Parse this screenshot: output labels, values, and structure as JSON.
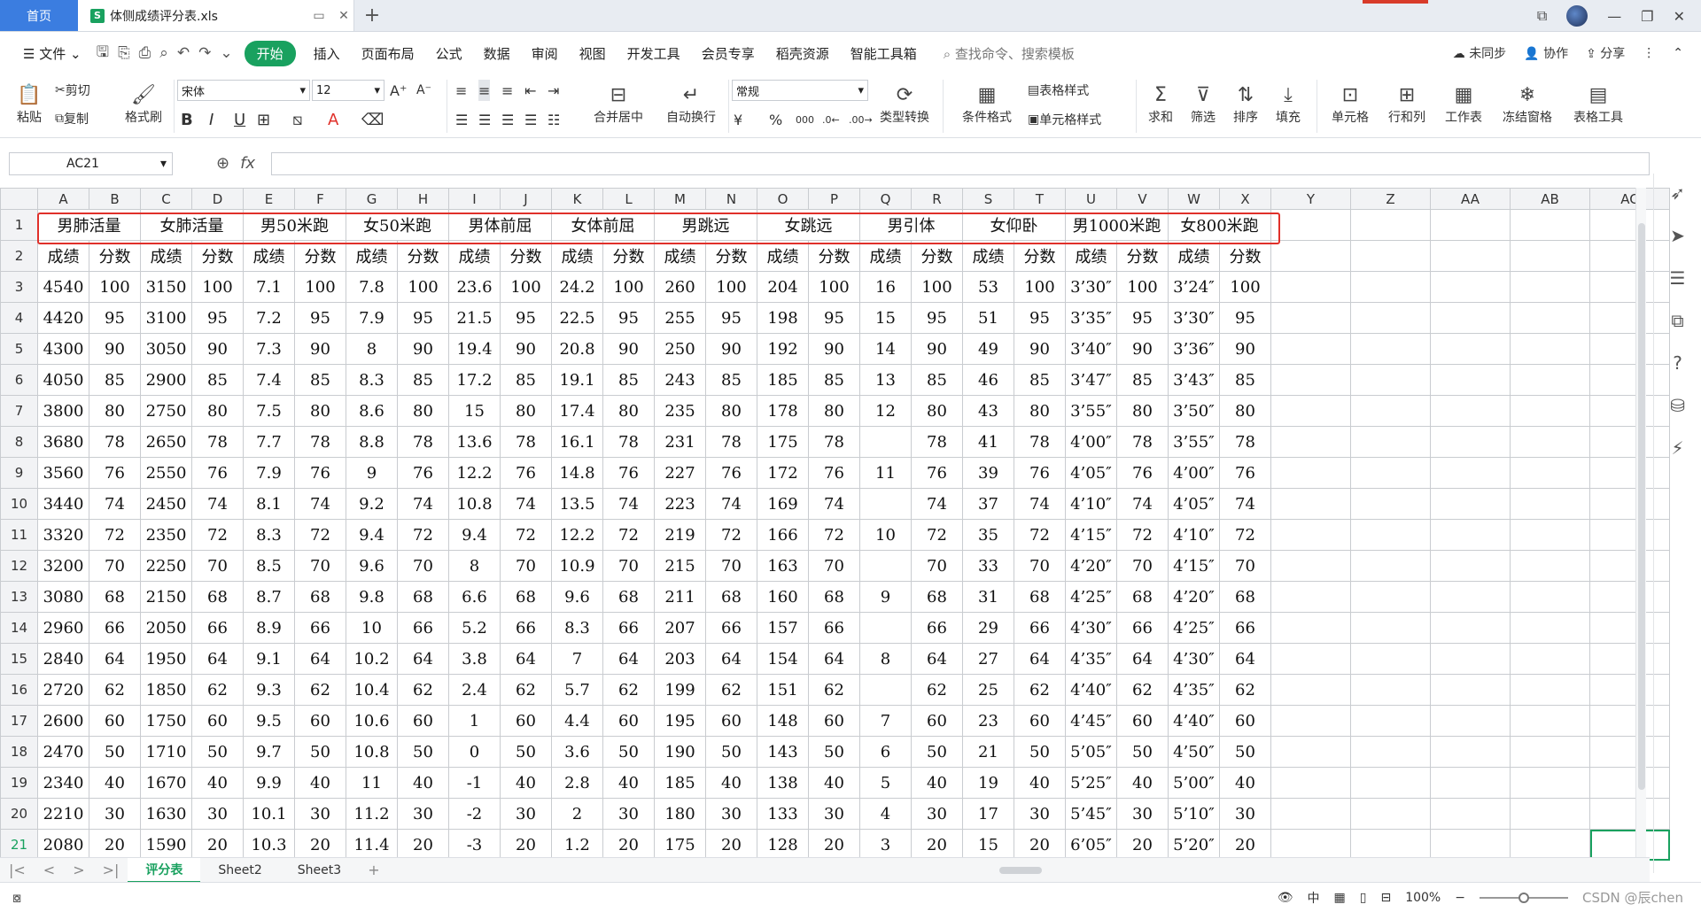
{
  "tabs": {
    "home": "首页",
    "file": "体侧成绩评分表.xls"
  },
  "menu": {
    "file": "文件",
    "start": "开始",
    "items": [
      "插入",
      "页面布局",
      "公式",
      "数据",
      "审阅",
      "视图",
      "开发工具",
      "会员专享",
      "稻壳资源",
      "智能工具箱"
    ],
    "search": "查找命令、搜索模板",
    "sync": "未同步",
    "collab": "协作",
    "share": "分享"
  },
  "ribbon": {
    "paste": "粘贴",
    "cut": "剪切",
    "copy": "复制",
    "format_painter": "格式刷",
    "font_name": "宋体",
    "font_size": "12",
    "merge": "合并居中",
    "wrap": "自动换行",
    "number_format": "常规",
    "convert": "类型转换",
    "cond_format": "条件格式",
    "table_style": "表格样式",
    "cell_style": "单元格样式",
    "sum": "求和",
    "filter": "筛选",
    "sort": "排序",
    "fill": "填充",
    "cell": "单元格",
    "rowcol": "行和列",
    "sheet": "工作表",
    "freeze": "冻结窗格",
    "tools": "表格工具"
  },
  "formula": {
    "namebox": "AC21",
    "fx": "fx"
  },
  "columns": [
    "A",
    "B",
    "C",
    "D",
    "E",
    "F",
    "G",
    "H",
    "I",
    "J",
    "K",
    "L",
    "M",
    "N",
    "O",
    "P",
    "Q",
    "R",
    "S",
    "T",
    "U",
    "V",
    "W",
    "X",
    "Y",
    "Z",
    "AA",
    "AB",
    "AC"
  ],
  "header_row": [
    "男肺活量",
    "女肺活量",
    "男50米跑",
    "女50米跑",
    "男体前屈",
    "女体前屈",
    "男跳远",
    "女跳远",
    "男引体",
    "女仰卧",
    "男1000米跑",
    "女800米跑"
  ],
  "sub_header": [
    "成绩",
    "分数"
  ],
  "rows": [
    [
      "4540",
      "100",
      "3150",
      "100",
      "7.1",
      "100",
      "7.8",
      "100",
      "23.6",
      "100",
      "24.2",
      "100",
      "260",
      "100",
      "204",
      "100",
      "16",
      "100",
      "53",
      "100",
      "3’30″",
      "100",
      "3’24″",
      "100"
    ],
    [
      "4420",
      "95",
      "3100",
      "95",
      "7.2",
      "95",
      "7.9",
      "95",
      "21.5",
      "95",
      "22.5",
      "95",
      "255",
      "95",
      "198",
      "95",
      "15",
      "95",
      "51",
      "95",
      "3’35″",
      "95",
      "3’30″",
      "95"
    ],
    [
      "4300",
      "90",
      "3050",
      "90",
      "7.3",
      "90",
      "8",
      "90",
      "19.4",
      "90",
      "20.8",
      "90",
      "250",
      "90",
      "192",
      "90",
      "14",
      "90",
      "49",
      "90",
      "3’40″",
      "90",
      "3’36″",
      "90"
    ],
    [
      "4050",
      "85",
      "2900",
      "85",
      "7.4",
      "85",
      "8.3",
      "85",
      "17.2",
      "85",
      "19.1",
      "85",
      "243",
      "85",
      "185",
      "85",
      "13",
      "85",
      "46",
      "85",
      "3’47″",
      "85",
      "3’43″",
      "85"
    ],
    [
      "3800",
      "80",
      "2750",
      "80",
      "7.5",
      "80",
      "8.6",
      "80",
      "15",
      "80",
      "17.4",
      "80",
      "235",
      "80",
      "178",
      "80",
      "12",
      "80",
      "43",
      "80",
      "3’55″",
      "80",
      "3’50″",
      "80"
    ],
    [
      "3680",
      "78",
      "2650",
      "78",
      "7.7",
      "78",
      "8.8",
      "78",
      "13.6",
      "78",
      "16.1",
      "78",
      "231",
      "78",
      "175",
      "78",
      "",
      "78",
      "41",
      "78",
      "4’00″",
      "78",
      "3’55″",
      "78"
    ],
    [
      "3560",
      "76",
      "2550",
      "76",
      "7.9",
      "76",
      "9",
      "76",
      "12.2",
      "76",
      "14.8",
      "76",
      "227",
      "76",
      "172",
      "76",
      "11",
      "76",
      "39",
      "76",
      "4’05″",
      "76",
      "4’00″",
      "76"
    ],
    [
      "3440",
      "74",
      "2450",
      "74",
      "8.1",
      "74",
      "9.2",
      "74",
      "10.8",
      "74",
      "13.5",
      "74",
      "223",
      "74",
      "169",
      "74",
      "",
      "74",
      "37",
      "74",
      "4’10″",
      "74",
      "4’05″",
      "74"
    ],
    [
      "3320",
      "72",
      "2350",
      "72",
      "8.3",
      "72",
      "9.4",
      "72",
      "9.4",
      "72",
      "12.2",
      "72",
      "219",
      "72",
      "166",
      "72",
      "10",
      "72",
      "35",
      "72",
      "4’15″",
      "72",
      "4’10″",
      "72"
    ],
    [
      "3200",
      "70",
      "2250",
      "70",
      "8.5",
      "70",
      "9.6",
      "70",
      "8",
      "70",
      "10.9",
      "70",
      "215",
      "70",
      "163",
      "70",
      "",
      "70",
      "33",
      "70",
      "4’20″",
      "70",
      "4’15″",
      "70"
    ],
    [
      "3080",
      "68",
      "2150",
      "68",
      "8.7",
      "68",
      "9.8",
      "68",
      "6.6",
      "68",
      "9.6",
      "68",
      "211",
      "68",
      "160",
      "68",
      "9",
      "68",
      "31",
      "68",
      "4’25″",
      "68",
      "4’20″",
      "68"
    ],
    [
      "2960",
      "66",
      "2050",
      "66",
      "8.9",
      "66",
      "10",
      "66",
      "5.2",
      "66",
      "8.3",
      "66",
      "207",
      "66",
      "157",
      "66",
      "",
      "66",
      "29",
      "66",
      "4’30″",
      "66",
      "4’25″",
      "66"
    ],
    [
      "2840",
      "64",
      "1950",
      "64",
      "9.1",
      "64",
      "10.2",
      "64",
      "3.8",
      "64",
      "7",
      "64",
      "203",
      "64",
      "154",
      "64",
      "8",
      "64",
      "27",
      "64",
      "4’35″",
      "64",
      "4’30″",
      "64"
    ],
    [
      "2720",
      "62",
      "1850",
      "62",
      "9.3",
      "62",
      "10.4",
      "62",
      "2.4",
      "62",
      "5.7",
      "62",
      "199",
      "62",
      "151",
      "62",
      "",
      "62",
      "25",
      "62",
      "4’40″",
      "62",
      "4’35″",
      "62"
    ],
    [
      "2600",
      "60",
      "1750",
      "60",
      "9.5",
      "60",
      "10.6",
      "60",
      "1",
      "60",
      "4.4",
      "60",
      "195",
      "60",
      "148",
      "60",
      "7",
      "60",
      "23",
      "60",
      "4’45″",
      "60",
      "4’40″",
      "60"
    ],
    [
      "2470",
      "50",
      "1710",
      "50",
      "9.7",
      "50",
      "10.8",
      "50",
      "0",
      "50",
      "3.6",
      "50",
      "190",
      "50",
      "143",
      "50",
      "6",
      "50",
      "21",
      "50",
      "5’05″",
      "50",
      "4’50″",
      "50"
    ],
    [
      "2340",
      "40",
      "1670",
      "40",
      "9.9",
      "40",
      "11",
      "40",
      "-1",
      "40",
      "2.8",
      "40",
      "185",
      "40",
      "138",
      "40",
      "5",
      "40",
      "19",
      "40",
      "5’25″",
      "40",
      "5’00″",
      "40"
    ],
    [
      "2210",
      "30",
      "1630",
      "30",
      "10.1",
      "30",
      "11.2",
      "30",
      "-2",
      "30",
      "2",
      "30",
      "180",
      "30",
      "133",
      "30",
      "4",
      "30",
      "17",
      "30",
      "5’45″",
      "30",
      "5’10″",
      "30"
    ],
    [
      "2080",
      "20",
      "1590",
      "20",
      "10.3",
      "20",
      "11.4",
      "20",
      "-3",
      "20",
      "1.2",
      "20",
      "175",
      "20",
      "128",
      "20",
      "3",
      "20",
      "15",
      "20",
      "6’05″",
      "20",
      "5’20″",
      "20"
    ]
  ],
  "sheets": [
    "评分表",
    "Sheet2",
    "Sheet3"
  ],
  "status": {
    "zoom": "100%",
    "watermark": "CSDN @辰chen"
  }
}
